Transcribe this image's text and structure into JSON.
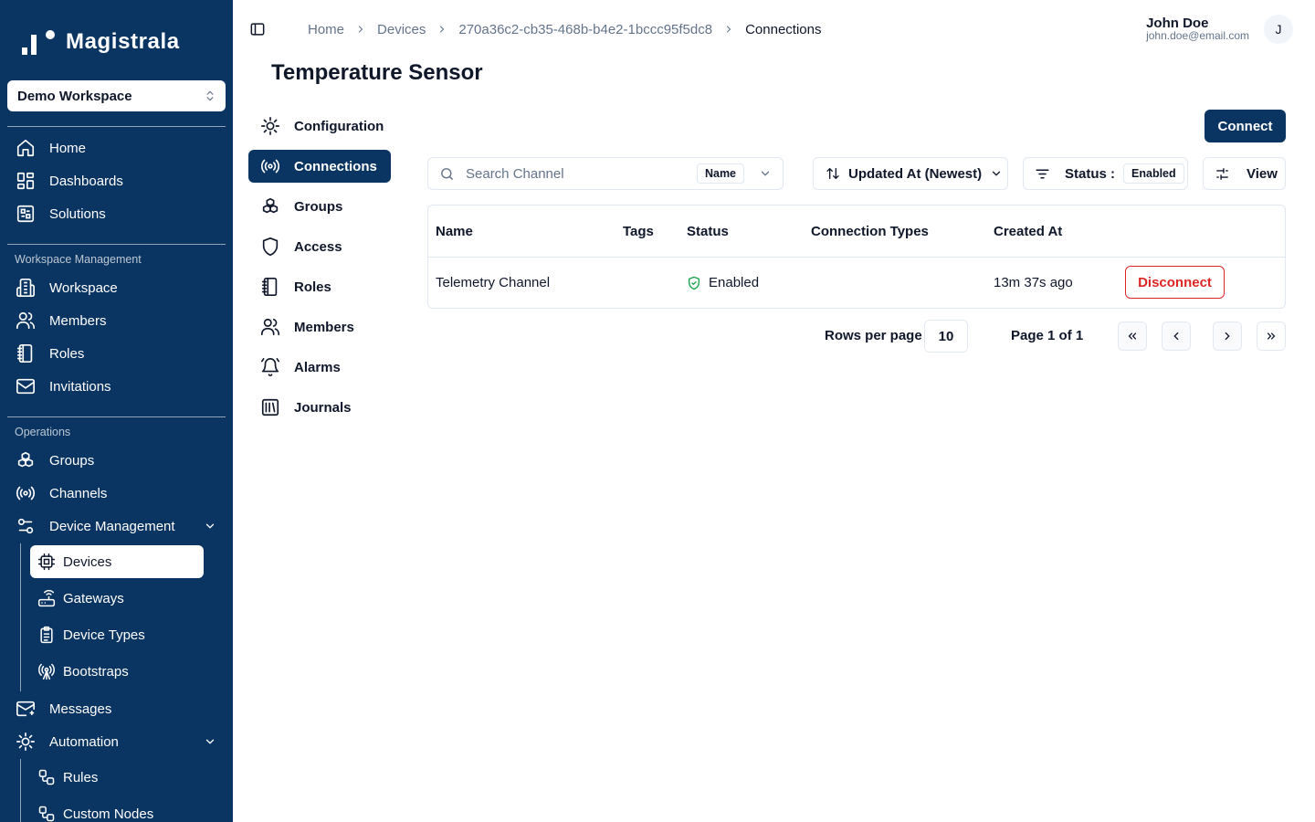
{
  "app": {
    "name": "Magistrala"
  },
  "workspace_select": {
    "value": "Demo Workspace"
  },
  "sidebar": {
    "main_items": [
      {
        "label": "Home",
        "icon": "home-icon"
      },
      {
        "label": "Dashboards",
        "icon": "dashboard-icon"
      },
      {
        "label": "Solutions",
        "icon": "solutions-icon"
      }
    ],
    "workspace_section": {
      "label": "Workspace Management",
      "items": [
        {
          "label": "Workspace",
          "icon": "building-icon"
        },
        {
          "label": "Members",
          "icon": "users-icon"
        },
        {
          "label": "Roles",
          "icon": "notebook-icon"
        },
        {
          "label": "Invitations",
          "icon": "mail-icon"
        }
      ]
    },
    "operations_section": {
      "label": "Operations",
      "items": [
        {
          "label": "Groups",
          "icon": "boxes-icon"
        },
        {
          "label": "Channels",
          "icon": "radio-icon"
        },
        {
          "label": "Device Management",
          "icon": "sliders-icon"
        }
      ],
      "device_management_children": [
        {
          "label": "Devices",
          "icon": "cpu-icon"
        },
        {
          "label": "Gateways",
          "icon": "router-icon"
        },
        {
          "label": "Device Types",
          "icon": "clipboard-list-icon"
        },
        {
          "label": "Bootstraps",
          "icon": "antenna-icon"
        }
      ],
      "more_items": [
        {
          "label": "Messages",
          "icon": "mail-open-icon"
        },
        {
          "label": "Automation",
          "icon": "cog-icon"
        }
      ],
      "automation_children": [
        {
          "label": "Rules",
          "icon": "workflow-icon"
        },
        {
          "label": "Custom Nodes",
          "icon": "workflow-icon"
        }
      ]
    }
  },
  "breadcrumb": [
    "Home",
    "Devices",
    "270a36c2-cb35-468b-b4e2-1bccc95f5dc8",
    "Connections"
  ],
  "user": {
    "name": "John Doe",
    "email": "john.doe@email.com",
    "avatar_initial": "J"
  },
  "page": {
    "title": "Temperature Sensor"
  },
  "entity_tabs": [
    {
      "label": "Configuration",
      "icon": "cog-icon"
    },
    {
      "label": "Connections",
      "icon": "radio-icon",
      "active": true
    },
    {
      "label": "Groups",
      "icon": "boxes-icon"
    },
    {
      "label": "Access",
      "icon": "shield-icon"
    },
    {
      "label": "Roles",
      "icon": "notebook-icon"
    },
    {
      "label": "Members",
      "icon": "users-icon"
    },
    {
      "label": "Alarms",
      "icon": "bell-icon"
    },
    {
      "label": "Journals",
      "icon": "library-icon"
    }
  ],
  "toolbar": {
    "connect_label": "Connect",
    "search_placeholder": "Search Channel",
    "search_value": "",
    "search_field": "Name",
    "sort_label": "Updated At (Newest)",
    "status_label": "Status :",
    "status_value": "Enabled",
    "view_label": "View"
  },
  "table": {
    "columns": [
      "Name",
      "Tags",
      "Status",
      "Connection Types",
      "Created At"
    ],
    "rows": [
      {
        "name": "Telemetry Channel",
        "tags": "",
        "status": "Enabled",
        "connection_types": "",
        "created_at": "13m 37s ago",
        "action": "Disconnect"
      }
    ]
  },
  "pagination": {
    "rows_per_page_label": "Rows per page",
    "rows_per_page": "10",
    "page_info": "Page 1 of 1"
  },
  "colors": {
    "sidebar_bg": "#0a3461",
    "primary": "#0a3461",
    "danger": "#dc2626",
    "success": "#16a34a",
    "border": "#e2e8f0",
    "muted_text": "#64748b"
  }
}
